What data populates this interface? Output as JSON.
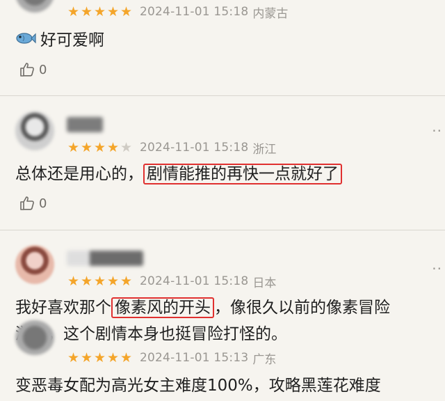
{
  "reviews": [
    {
      "stars": 5,
      "date": "2024-11-01 15:18",
      "region": "内蒙古",
      "text": "好可爱啊",
      "emoji": "fish-emoji",
      "likes": "0"
    },
    {
      "stars": 4,
      "date": "2024-11-01 15:18",
      "region": "浙江",
      "text_prefix": "总体还是用心的，",
      "text_highlight": "剧情能推的再快一点就好了",
      "likes": "0"
    },
    {
      "stars": 5,
      "date": "2024-11-01 15:18",
      "region": "日本",
      "text_prefix": "我好喜欢那个",
      "text_highlight": "像素风的开头",
      "text_suffix": "，像很久以前的像素冒险",
      "text_line2": "游戏，这个剧情本身也挺冒险打怪的。"
    },
    {
      "stars": 5,
      "date": "2024-11-01 15:13",
      "region": "广东",
      "text": "变恶毒女配为高光女主难度100%，攻略黑莲花难度"
    }
  ],
  "more_label": "··",
  "colors": {
    "star": "#f4a52a",
    "highlight_border": "#e0302f",
    "meta": "#9a9792"
  }
}
